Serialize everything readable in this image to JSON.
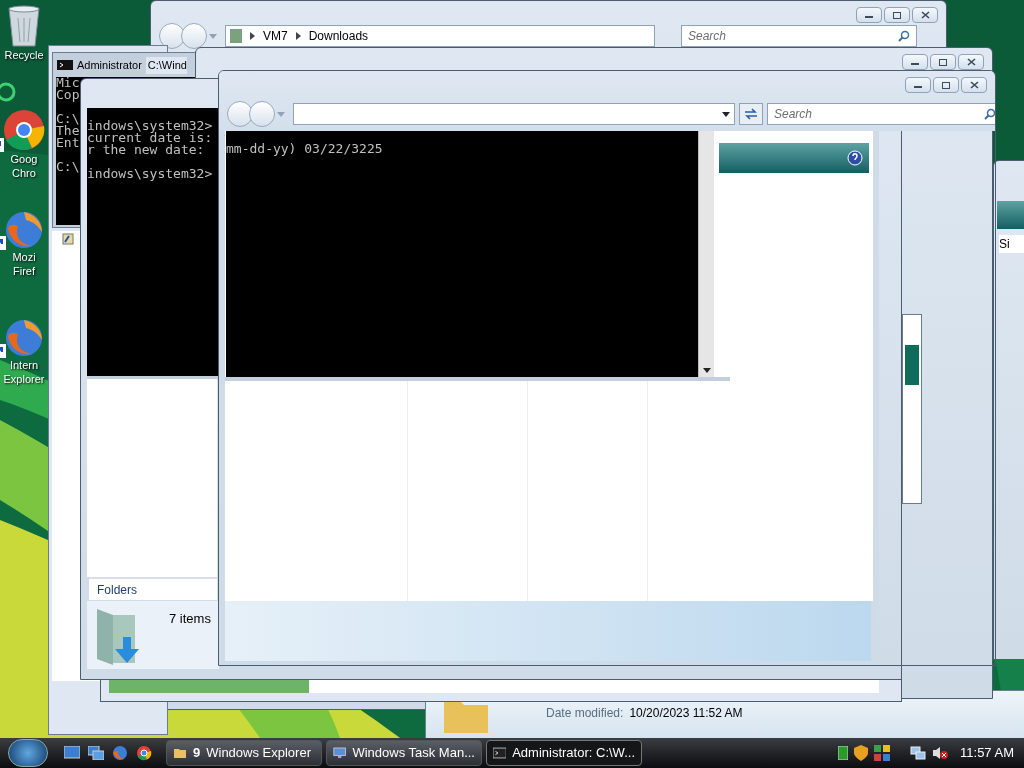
{
  "desktop_icons": [
    {
      "kind": "recycle",
      "lines": [
        "Recycle"
      ]
    },
    {
      "kind": "chrome",
      "lines": [
        "Goog",
        "Chro"
      ]
    },
    {
      "kind": "firefox",
      "lines": [
        "Mozi",
        "Firef"
      ]
    },
    {
      "kind": "firefox",
      "lines": [
        "Intern",
        "Explorer"
      ]
    }
  ],
  "back_explorer": {
    "breadcrumbs": [
      "VM7",
      "Downloads"
    ],
    "search": {
      "placeholder": "Search"
    }
  },
  "far_right_window": {
    "column_1": "Si"
  },
  "console_window": {
    "title": "Administrator",
    "title_tail": "C:\\Wind",
    "blocks": [
      [
        "Mic",
        "Cop"
      ],
      [
        "C:\\",
        "The",
        "Ent"
      ],
      [
        "C:\\"
      ]
    ]
  },
  "middle_window": {
    "console_blocks": [
      [
        "indows\\system32>",
        "current date is:",
        "r the new date:"
      ],
      [
        "indows\\system32>"
      ]
    ],
    "folders_button": "Folders",
    "item_count": "7 items"
  },
  "front_explorer": {
    "search": {
      "placeholder": "Search"
    },
    "console_blocks": [
      [
        "mm-dd-yy) 03/22/3225"
      ]
    ]
  },
  "details_window": {
    "label": "Date modified:",
    "value": "10/20/2023 11:52 AM"
  },
  "progress_window": {
    "level": 0.26
  },
  "taskbar": {
    "tasks": [
      {
        "kind": "explorer",
        "count": "9",
        "label": "Windows Explorer",
        "selected": false
      },
      {
        "kind": "taskmgr",
        "label": "Windows Task Man...",
        "selected": false
      },
      {
        "kind": "console",
        "label": "Administrator: C:\\W...",
        "selected": true
      }
    ],
    "clock": "11:57 AM"
  }
}
